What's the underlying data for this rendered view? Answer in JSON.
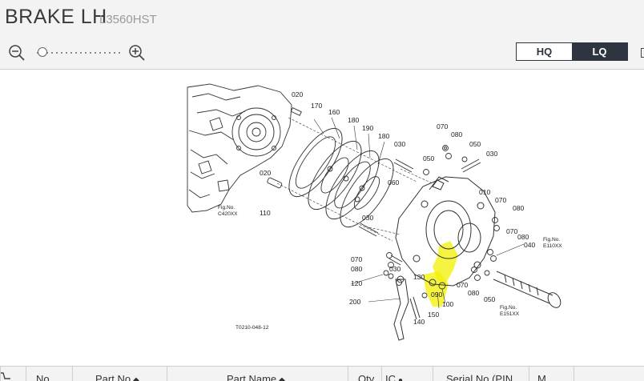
{
  "header": {
    "title": "BRAKE LH",
    "model": "L3560HST"
  },
  "toolbar": {
    "zoom_out_icon": "zoom-out-icon",
    "zoom_in_icon": "zoom-in-icon",
    "zoom_level": 0.05,
    "quality_options": [
      "HQ",
      "LQ"
    ],
    "selected_quality": "LQ"
  },
  "diagram": {
    "labels": {
      "l020a": "020",
      "l170": "170",
      "l160": "160",
      "l180a": "180",
      "l190": "190",
      "l180b": "180",
      "l030a": "030",
      "l070a": "070",
      "l080a": "080",
      "l050a": "050",
      "l030b": "030",
      "l050b": "050",
      "l020b": "020",
      "l060": "060",
      "l010": "010",
      "l070b": "070",
      "l080b": "080",
      "l030c": "030",
      "l110": "110",
      "l070c": "070",
      "l080c": "080",
      "l040": "040",
      "l070d": "070",
      "l080d": "080",
      "l030d": "030",
      "l120": "120",
      "l130": "130",
      "l070e": "070",
      "l080e": "080",
      "l050c": "050",
      "l090": "090",
      "l100": "100",
      "l200": "200",
      "l150": "150",
      "l140": "140"
    },
    "fig_refs": {
      "c420_label": "Fig.No.",
      "c420": "C420XX",
      "e110_label": "Fig.No.",
      "e110": "E110XX",
      "e151_label": "Fig.No.",
      "e151": "E151XX"
    },
    "drawing_code": "T0210-048-12",
    "highlight_color": "#f2f000"
  },
  "table": {
    "columns": [
      "No",
      "Part No",
      "Part Name",
      "Qty",
      "IC",
      "Serial No (PIN",
      "M"
    ]
  }
}
